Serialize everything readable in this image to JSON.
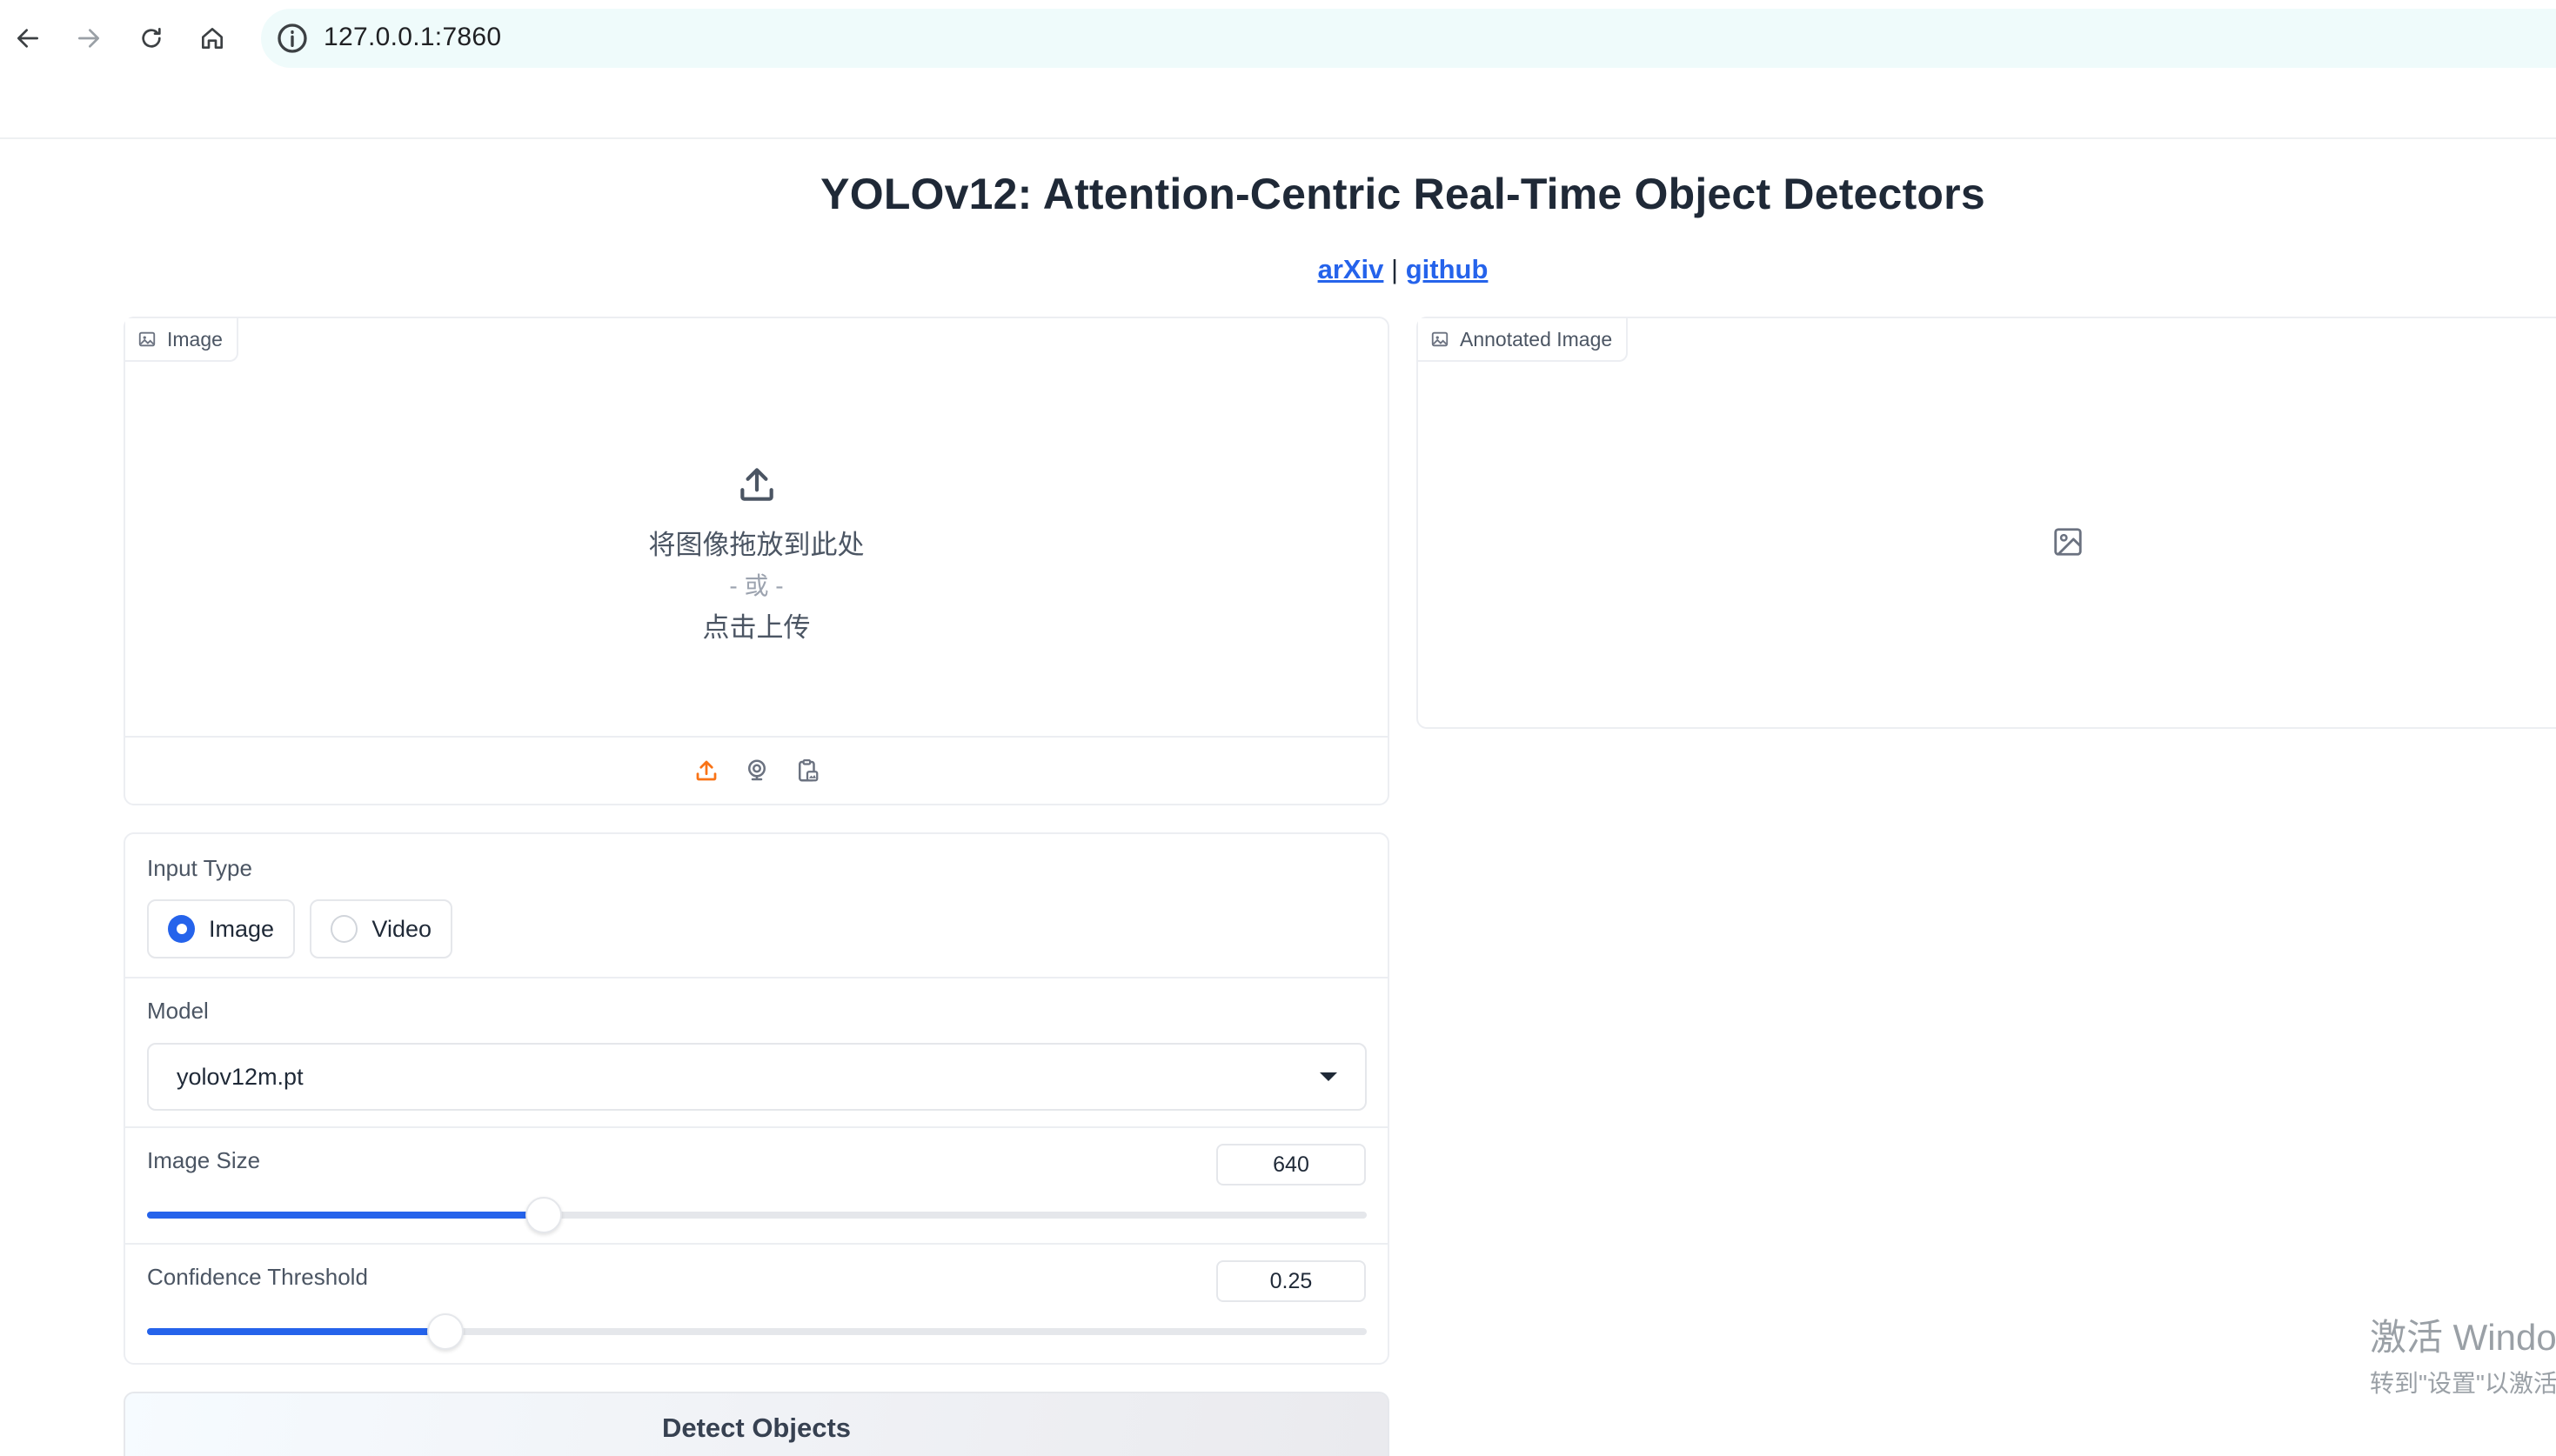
{
  "browser": {
    "url": "127.0.0.1:7860"
  },
  "header": {
    "title": "YOLOv12: Attention-Centric Real-Time Object Detectors",
    "link_arxiv": "arXiv",
    "separator": "|",
    "link_github": "github"
  },
  "input_panel": {
    "label": "Image",
    "drop_text": "将图像拖放到此处",
    "or_text": "- 或 -",
    "click_text": "点击上传",
    "sources": [
      "upload-icon",
      "webcam-icon",
      "clipboard-icon"
    ],
    "accent": "#f97316"
  },
  "output_panel": {
    "label": "Annotated Image"
  },
  "controls": {
    "input_type": {
      "label": "Input Type",
      "options": [
        "Image",
        "Video"
      ],
      "selected": "Image"
    },
    "model": {
      "label": "Model",
      "value": "yolov12m.pt"
    },
    "image_size": {
      "label": "Image Size",
      "value": "640",
      "fill_fraction": 0.325
    },
    "confidence": {
      "label": "Confidence Threshold",
      "value": "0.25",
      "fill_fraction": 0.245
    }
  },
  "detect_button": {
    "label": "Detect Objects"
  },
  "watermark": {
    "line1": "激活 Windo",
    "line2": "转到\"设置\"以激活"
  },
  "colors": {
    "accent_blue": "#2563eb",
    "upload_orange": "#f97316"
  }
}
